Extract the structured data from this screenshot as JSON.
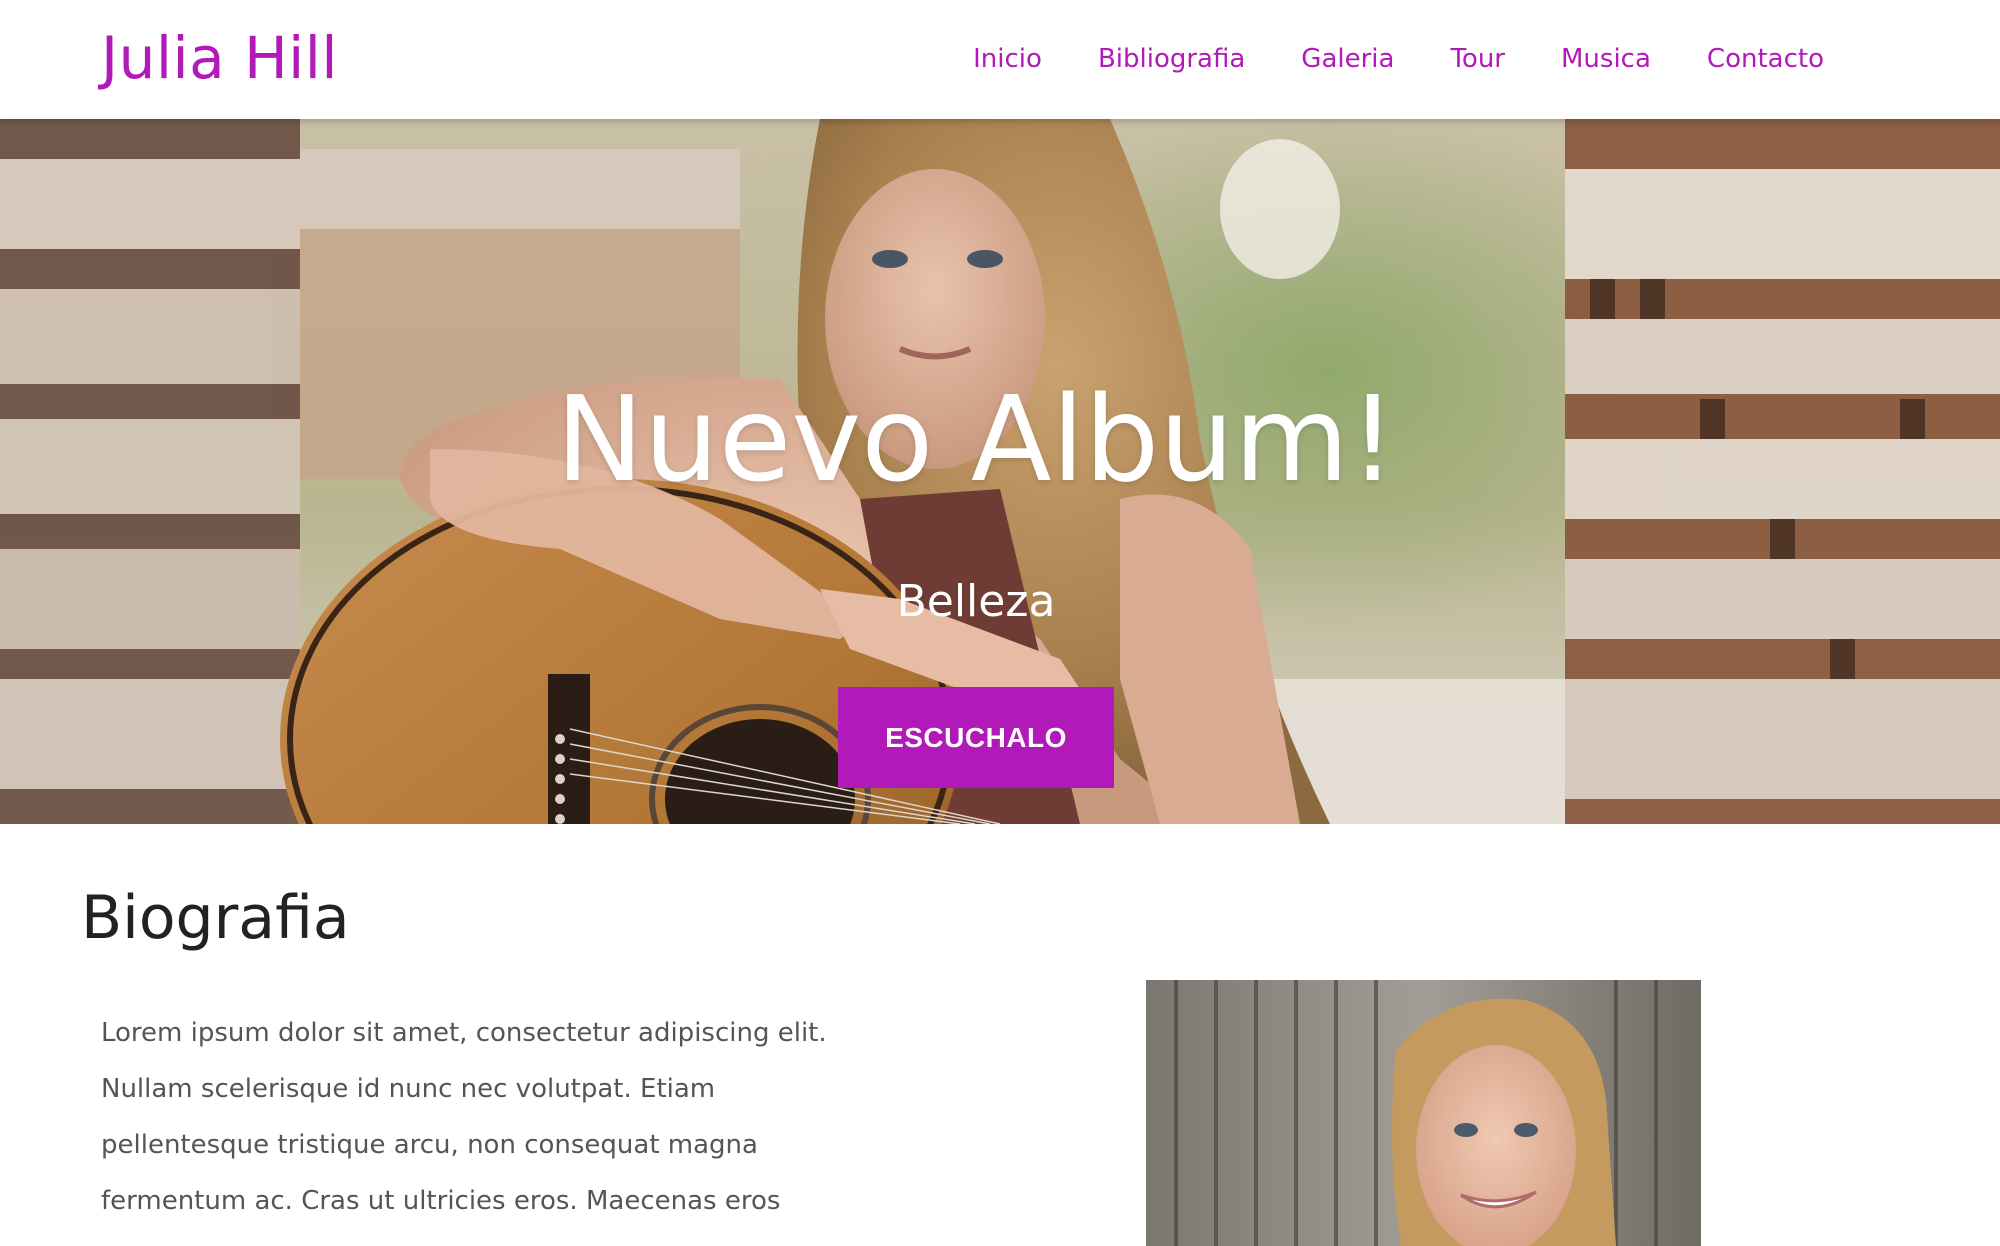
{
  "header": {
    "logo": "Julia Hill",
    "nav": [
      "Inicio",
      "Bibliografia",
      "Galeria",
      "Tour",
      "Musica",
      "Contacto"
    ]
  },
  "hero": {
    "title": "Nuevo Album!",
    "subtitle": "Belleza",
    "cta_label": "ESCUCHALO"
  },
  "biography": {
    "heading": "Biografia",
    "lines": [
      "Lorem ipsum dolor sit amet, consectetur adipiscing elit.",
      "Nullam scelerisque id nunc nec volutpat. Etiam",
      "pellentesque tristique arcu, non consequat magna",
      "fermentum ac. Cras ut ultricies eros. Maecenas eros"
    ]
  },
  "colors": {
    "accent": "#b11ab8",
    "heading": "#222222",
    "body_text": "#555555"
  }
}
